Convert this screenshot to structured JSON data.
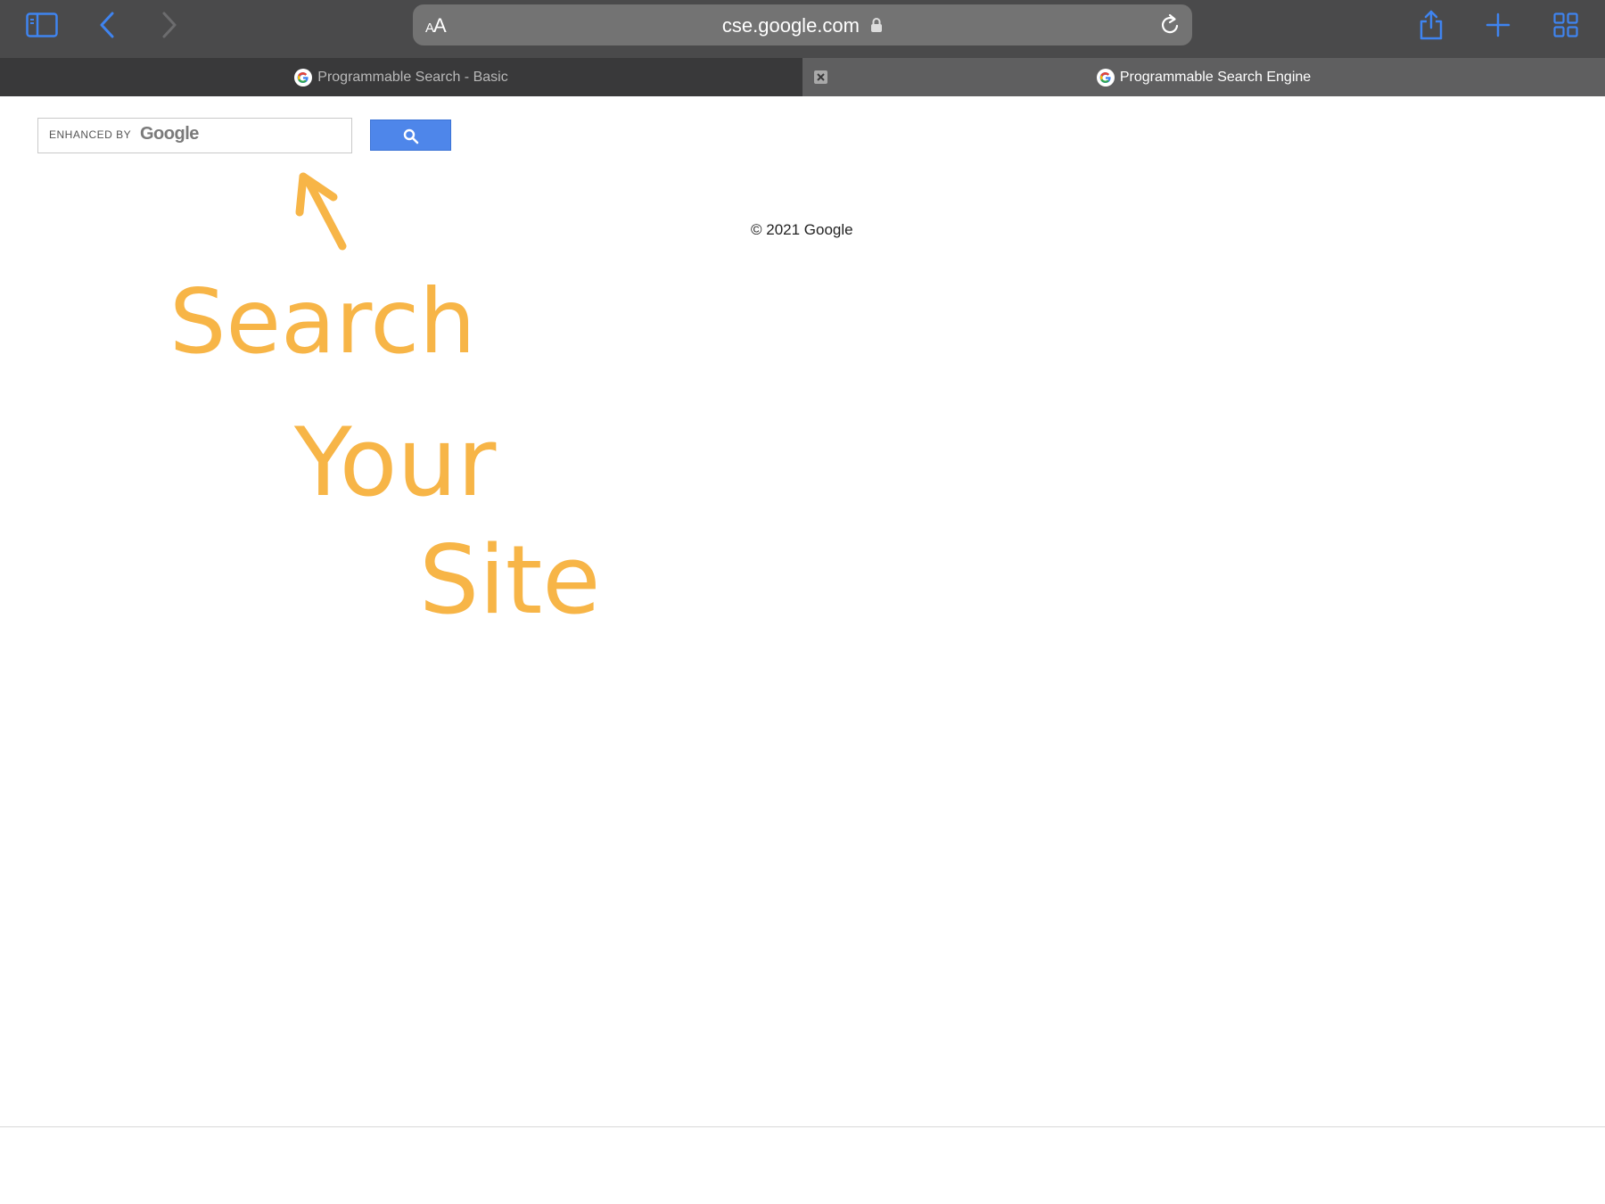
{
  "toolbar": {
    "aa_small": "A",
    "aa_large": "A",
    "url": "cse.google.com"
  },
  "tabs": [
    {
      "label": "Programmable Search - Basic"
    },
    {
      "label": "Programmable Search Engine"
    }
  ],
  "search": {
    "enhanced_by": "ENHANCED BY",
    "brand": "Google",
    "query": ""
  },
  "footer": {
    "copyright": "© 2021 Google"
  },
  "annotation": {
    "line1": "Search",
    "line2": "Your",
    "line3": "Site",
    "color": "#f7b547"
  },
  "colors": {
    "accent_blue": "#4e86ea",
    "toolbar": "#4a4a4b"
  }
}
